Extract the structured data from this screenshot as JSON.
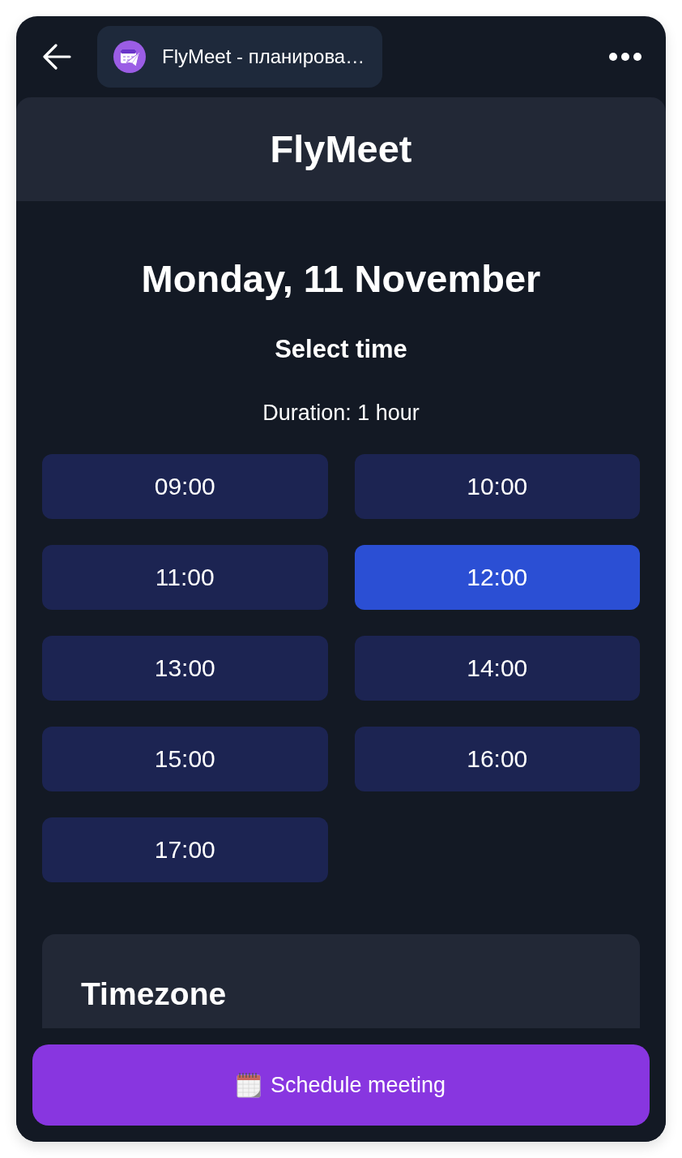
{
  "top_bar": {
    "page_title": "FlyMeet - планирова…"
  },
  "header": {
    "title": "FlyMeet"
  },
  "schedule": {
    "date": "Monday, 11 November",
    "subtitle": "Select time",
    "duration": "Duration: 1 hour"
  },
  "time_slots": [
    {
      "label": "09:00",
      "selected": false
    },
    {
      "label": "10:00",
      "selected": false
    },
    {
      "label": "11:00",
      "selected": false
    },
    {
      "label": "12:00",
      "selected": true
    },
    {
      "label": "13:00",
      "selected": false
    },
    {
      "label": "14:00",
      "selected": false
    },
    {
      "label": "15:00",
      "selected": false
    },
    {
      "label": "16:00",
      "selected": false
    },
    {
      "label": "17:00",
      "selected": false
    }
  ],
  "timezone": {
    "title": "Timezone"
  },
  "action_button": {
    "label": "Schedule meeting"
  }
}
